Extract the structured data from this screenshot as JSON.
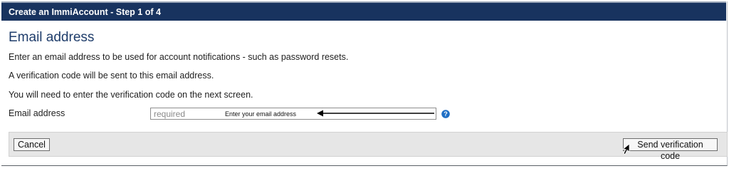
{
  "window": {
    "title": "Create an ImmiAccount - Step 1 of 4"
  },
  "section": {
    "heading": "Email address",
    "paragraphs": [
      "Enter an email address to be used for account notifications - such as password resets.",
      "A verification code will be sent to this email address.",
      "You will need to enter the verification code on the next screen."
    ]
  },
  "form": {
    "email": {
      "label": "Email address",
      "value": "",
      "placeholder": "required",
      "annotation": "Enter your email address",
      "help_icon": "question-circle-icon"
    }
  },
  "footer": {
    "cancel_label": "Cancel",
    "send_label": "Send verification code"
  },
  "colors": {
    "titlebar": "#18335f",
    "heading": "#1f3d6b",
    "help_icon": "#1f6fc5",
    "footer_bg": "#e6e6e6"
  }
}
